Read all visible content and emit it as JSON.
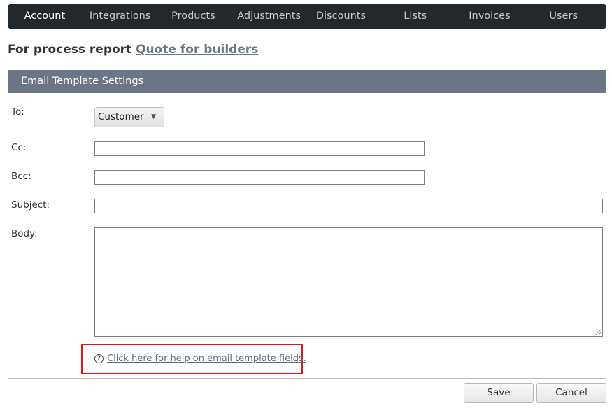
{
  "nav": {
    "items": [
      {
        "label": "Account",
        "active": true
      },
      {
        "label": "Integrations",
        "active": false
      },
      {
        "label": "Products",
        "active": false
      },
      {
        "label": "Adjustments",
        "active": false
      },
      {
        "label": "Discounts",
        "active": false
      },
      {
        "label": "Lists",
        "active": false
      },
      {
        "label": "Invoices",
        "active": false
      },
      {
        "label": "Users",
        "active": false
      }
    ]
  },
  "heading": {
    "prefix": "For process report",
    "link": "Quote for builders"
  },
  "section": {
    "title": "Email Template Settings"
  },
  "form": {
    "to_label": "To:",
    "to_value": "Customer",
    "cc_label": "Cc:",
    "cc_value": "",
    "bcc_label": "Bcc:",
    "bcc_value": "",
    "subject_label": "Subject:",
    "subject_value": "",
    "body_label": "Body:",
    "body_value": ""
  },
  "help": {
    "icon": "question-circle-icon",
    "link": "Click here for help on email template fields."
  },
  "buttons": {
    "save": "Save",
    "cancel": "Cancel"
  },
  "colors": {
    "navbar": "#23282d",
    "section_bar": "#6b7584",
    "highlight": "#e3141b"
  }
}
